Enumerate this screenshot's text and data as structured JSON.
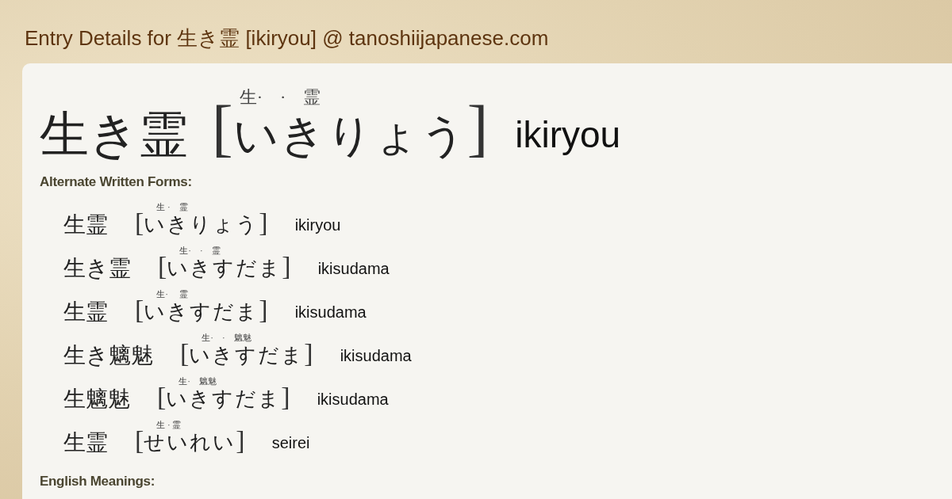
{
  "page_title": "Entry Details for 生き霊 [ikiryou] @ tanoshiijapanese.com",
  "entry": {
    "word": "生き霊",
    "open_bracket": "[",
    "furigana": "生·　·　霊",
    "reading": "いきりょう",
    "close_bracket": "]",
    "romaji": "ikiryou"
  },
  "alternate_forms_heading": "Alternate Written Forms:",
  "alternate_forms": [
    {
      "word": "生霊",
      "open_bracket": "[",
      "furigana": "生 ·　霊",
      "reading": "いきりょう",
      "close_bracket": "]",
      "romaji": "ikiryou"
    },
    {
      "word": "生き霊",
      "open_bracket": "[",
      "furigana": "生·　·　霊",
      "reading": "いきすだま",
      "close_bracket": "]",
      "romaji": "ikisudama"
    },
    {
      "word": "生霊",
      "open_bracket": "[",
      "furigana": "生·　 霊",
      "reading": "いきすだま",
      "close_bracket": "]",
      "romaji": "ikisudama"
    },
    {
      "word": "生き魑魅",
      "open_bracket": "[",
      "furigana": "生·　·　魑魅",
      "reading": "いきすだま",
      "close_bracket": "]",
      "romaji": "ikisudama"
    },
    {
      "word": "生魑魅",
      "open_bracket": "[",
      "furigana": "生·　魑魅",
      "reading": "いきすだま",
      "close_bracket": "]",
      "romaji": "ikisudama"
    },
    {
      "word": "生霊",
      "open_bracket": "[",
      "furigana": "生 · 霊",
      "reading": "せいれい",
      "close_bracket": "]",
      "romaji": "seirei"
    }
  ],
  "meanings_heading": "English Meanings:"
}
